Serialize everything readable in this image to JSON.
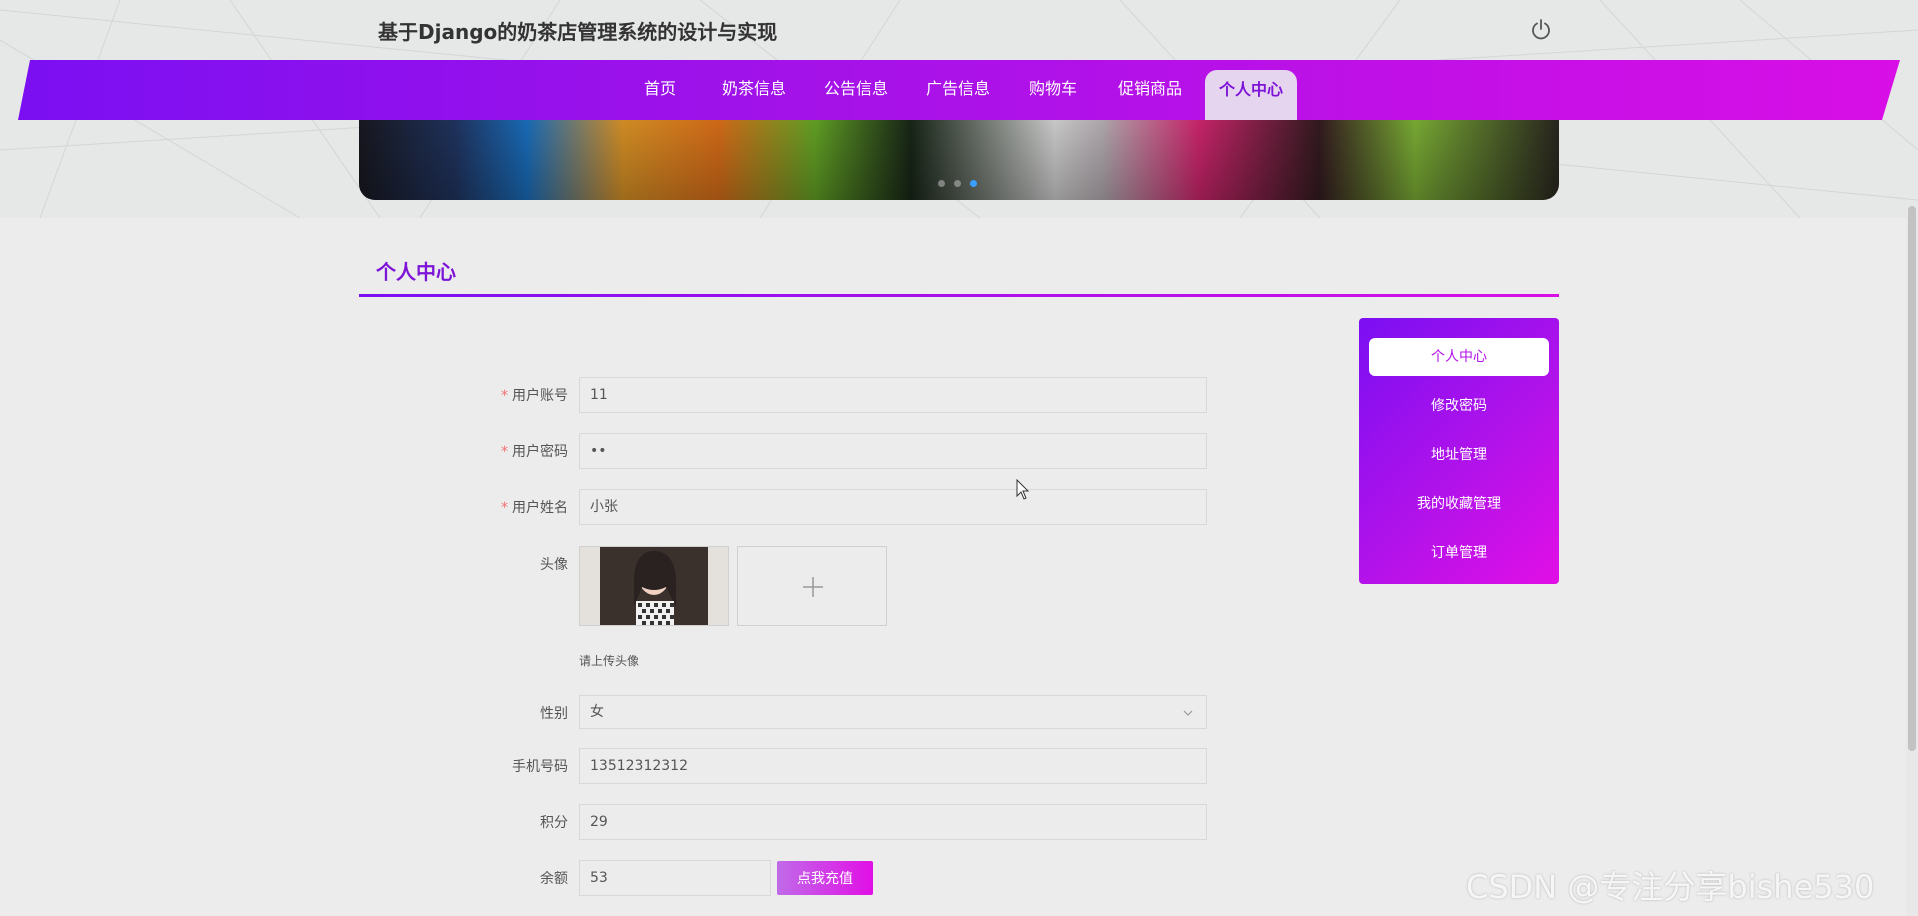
{
  "header": {
    "site_title": "基于Django的奶茶店管理系统的设计与实现"
  },
  "nav": {
    "items": [
      {
        "label": "首页"
      },
      {
        "label": "奶茶信息"
      },
      {
        "label": "公告信息"
      },
      {
        "label": "广告信息"
      },
      {
        "label": "购物车"
      },
      {
        "label": "促销商品"
      },
      {
        "label": "个人中心"
      }
    ],
    "active": "个人中心"
  },
  "carousel": {
    "slide_count": 3,
    "active_index": 2
  },
  "section": {
    "title": "个人中心"
  },
  "side_menu": {
    "items": [
      {
        "label": "个人中心"
      },
      {
        "label": "修改密码"
      },
      {
        "label": "地址管理"
      },
      {
        "label": "我的收藏管理"
      },
      {
        "label": "订单管理"
      }
    ],
    "active": "个人中心"
  },
  "form": {
    "account": {
      "label": "用户账号",
      "value": "11",
      "required": true
    },
    "password": {
      "label": "用户密码",
      "value": "••",
      "required": true
    },
    "name": {
      "label": "用户姓名",
      "value": "小张",
      "required": true
    },
    "avatar": {
      "label": "头像",
      "hint": "请上传头像"
    },
    "gender": {
      "label": "性别",
      "value": "女"
    },
    "phone": {
      "label": "手机号码",
      "value": "13512312312"
    },
    "points": {
      "label": "积分",
      "value": "29"
    },
    "balance": {
      "label": "余额",
      "value": "53",
      "button": "点我充值"
    }
  },
  "watermark": "CSDN @专注分享bishe530",
  "colors": {
    "brand_start": "#7b0ff2",
    "brand_end": "#d80fe6",
    "accent_text": "#7d14d8",
    "required": "#f56c6c"
  }
}
